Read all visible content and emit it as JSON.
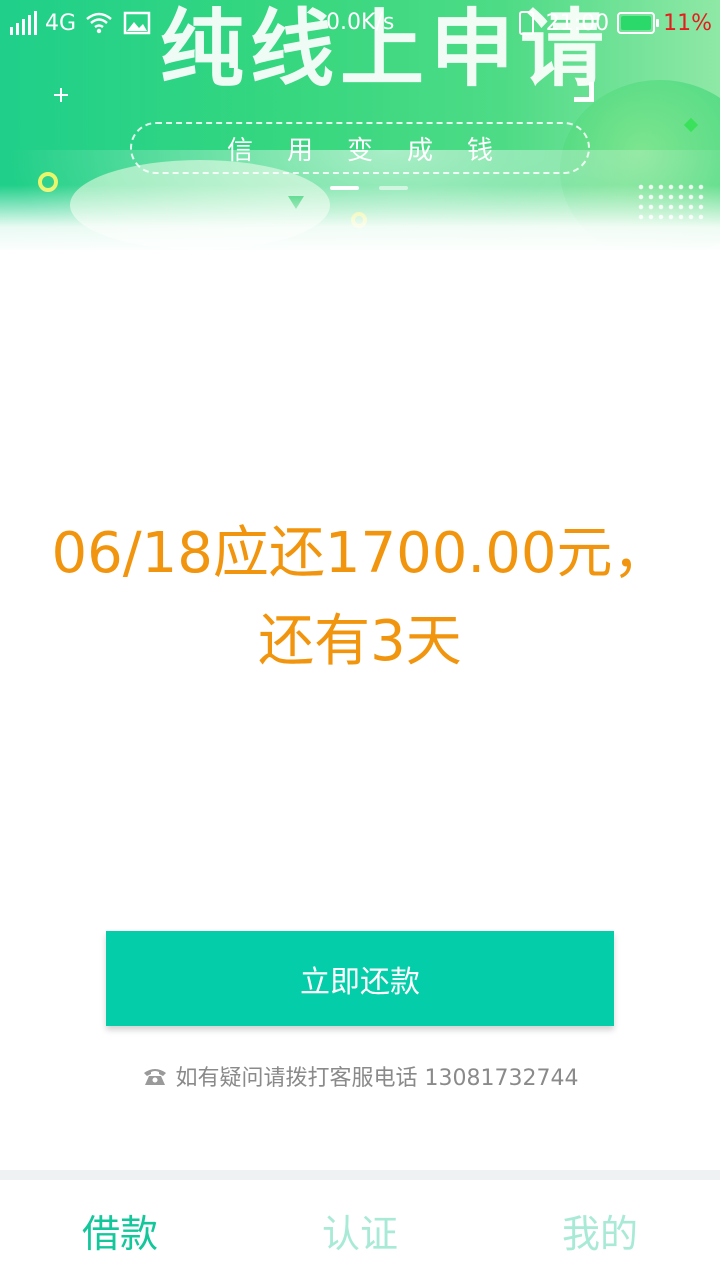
{
  "status_bar": {
    "network": "4G",
    "net_speed": "0.0K/s",
    "time": "21:00",
    "battery": "11%",
    "icons": [
      "signal-icon",
      "wifi-icon",
      "image-icon",
      "phone-icon",
      "battery-icon"
    ]
  },
  "banner": {
    "headline": "纯线上申请",
    "slogan": "信用变成钱",
    "page_count": 2,
    "active_page": 0
  },
  "notice": {
    "text": "06/18应还1700.00元，还有3天"
  },
  "repay_button": {
    "label": "立即还款"
  },
  "service": {
    "text": "如有疑问请拨打客服电话 13081732744",
    "icon": "telephone-icon"
  },
  "nav": {
    "items": [
      {
        "label": "借款",
        "active": true
      },
      {
        "label": "认证",
        "active": false
      },
      {
        "label": "我的",
        "active": false
      }
    ]
  },
  "colors": {
    "accent": "#04cda9",
    "nav_active": "#14c79b",
    "nav_inactive": "#a9ead7",
    "notice": "#f2950e",
    "battery_text": "#e81c1c"
  }
}
